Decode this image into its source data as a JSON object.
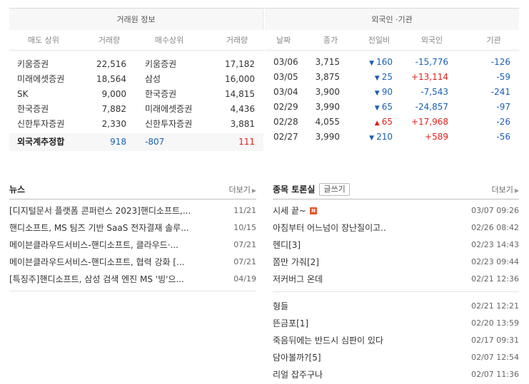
{
  "broker": {
    "title": "거래원 정보",
    "headers": [
      "매도 상위",
      "거래량",
      "매수상위",
      "거래량"
    ],
    "rows": [
      {
        "sell": "키움증권",
        "sell_vol": "22,516",
        "buy": "키움증권",
        "buy_vol": "17,182"
      },
      {
        "sell": "미래에셋증권",
        "sell_vol": "18,564",
        "buy": "삼성",
        "buy_vol": "16,000"
      },
      {
        "sell": "SK",
        "sell_vol": "9,000",
        "buy": "한국증권",
        "buy_vol": "14,815"
      },
      {
        "sell": "한국증권",
        "sell_vol": "7,882",
        "buy": "미래에셋증권",
        "buy_vol": "4,436"
      },
      {
        "sell": "신한투자증권",
        "sell_vol": "2,330",
        "buy": "신한투자증권",
        "buy_vol": "3,881"
      }
    ],
    "summary": {
      "label": "외국계추정합",
      "sell_vol": "918",
      "net": "-807",
      "buy_vol": "111"
    }
  },
  "foreign": {
    "title": "외국인 ·기관",
    "headers": [
      "날짜",
      "종가",
      "전일비",
      "외국인",
      "기관"
    ],
    "rows": [
      {
        "date": "03/06",
        "close": "3,715",
        "dir": "down",
        "change": "160",
        "foreigner": "-15,776",
        "inst": "-126"
      },
      {
        "date": "03/05",
        "close": "3,875",
        "dir": "down",
        "change": "25",
        "foreigner": "+13,114",
        "inst": "-59"
      },
      {
        "date": "03/04",
        "close": "3,900",
        "dir": "down",
        "change": "90",
        "foreigner": "-7,543",
        "inst": "-241"
      },
      {
        "date": "02/29",
        "close": "3,990",
        "dir": "down",
        "change": "65",
        "foreigner": "-24,857",
        "inst": "-97"
      },
      {
        "date": "02/28",
        "close": "4,055",
        "dir": "up",
        "change": "65",
        "foreigner": "+17,968",
        "inst": "-26"
      },
      {
        "date": "02/27",
        "close": "3,990",
        "dir": "down",
        "change": "210",
        "foreigner": "+589",
        "inst": "-56"
      }
    ]
  },
  "news": {
    "title": "뉴스",
    "more": "더보기",
    "items": [
      {
        "title": "[디지털문서 플랫폼 콘퍼런스 2023]핸디소프트,...",
        "date": "11/21"
      },
      {
        "title": "핸디소프트, MS 팀즈 기반 SaaS 전자결재 솔루...",
        "date": "10/15"
      },
      {
        "title": "메이븐클라우드서비스-핸디소프트, 클라우드·...",
        "date": "07/21"
      },
      {
        "title": "메이븐클라우드서비스-핸디소프트, 협력 강화 [...",
        "date": "07/21"
      },
      {
        "title": "[특징주]핸디소프트, 삼성 검색 엔진 MS '빙'으...",
        "date": "04/19"
      }
    ]
  },
  "board": {
    "title": "종목 토론실",
    "write": "글쓰기",
    "more": "더보기",
    "new_badge": "N",
    "group1": [
      {
        "title": "시세 끝~",
        "date": "03/07 09:26",
        "new": true
      },
      {
        "title": "아침부터 어느넘이 장난질이고..",
        "date": "02/26 08:42",
        "new": false
      },
      {
        "title": "헨디[3]",
        "date": "02/23 14:43",
        "new": false
      },
      {
        "title": "쫌만 가줘[2]",
        "date": "02/23 09:44",
        "new": false
      },
      {
        "title": "저커버그 온데",
        "date": "02/21 12:36",
        "new": false
      }
    ],
    "group2": [
      {
        "title": "형들",
        "date": "02/21 12:21",
        "new": false
      },
      {
        "title": "뜬금포[1]",
        "date": "02/20 13:59",
        "new": false
      },
      {
        "title": "죽음뒤에는 반드시 심판이 있다",
        "date": "02/17 09:31",
        "new": false
      },
      {
        "title": "담아볼까?[5]",
        "date": "02/07 12:54",
        "new": false
      },
      {
        "title": "리얼 잡주구나",
        "date": "02/07 11:36",
        "new": false
      }
    ]
  },
  "colors": {
    "down": "#1a5fb4",
    "up": "#e0201a",
    "badge": "#e8542b"
  },
  "icons": {
    "down": "▼",
    "up": "▲",
    "more_caret": "▶"
  }
}
